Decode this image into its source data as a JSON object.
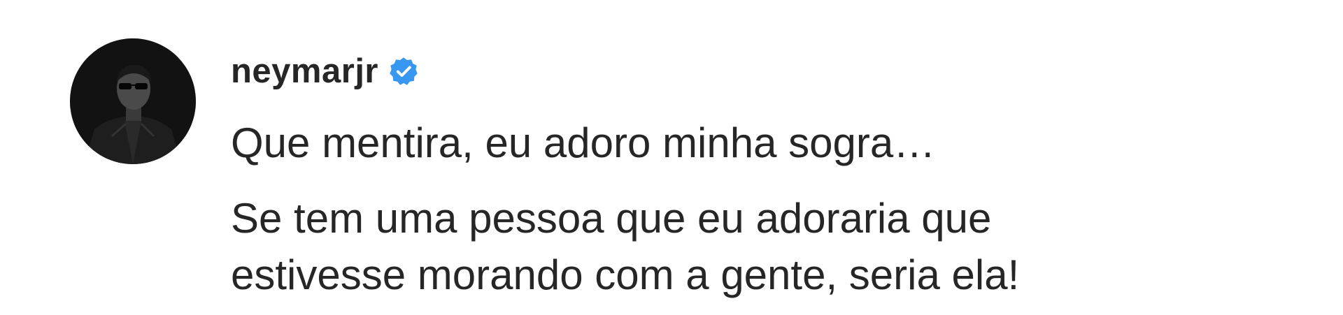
{
  "comment": {
    "username": "neymarjr",
    "verified_icon": "verified-badge-icon",
    "avatar_icon": "profile-photo",
    "text_lines": [
      "Que mentira, eu adoro minha sogra…",
      "Se tem uma pessoa que eu adoraria que",
      "estivesse morando com a gente, seria ela!"
    ]
  },
  "colors": {
    "text": "#262626",
    "verified_blue": "#3897f0",
    "background": "#ffffff",
    "avatar_background": "#111111"
  }
}
